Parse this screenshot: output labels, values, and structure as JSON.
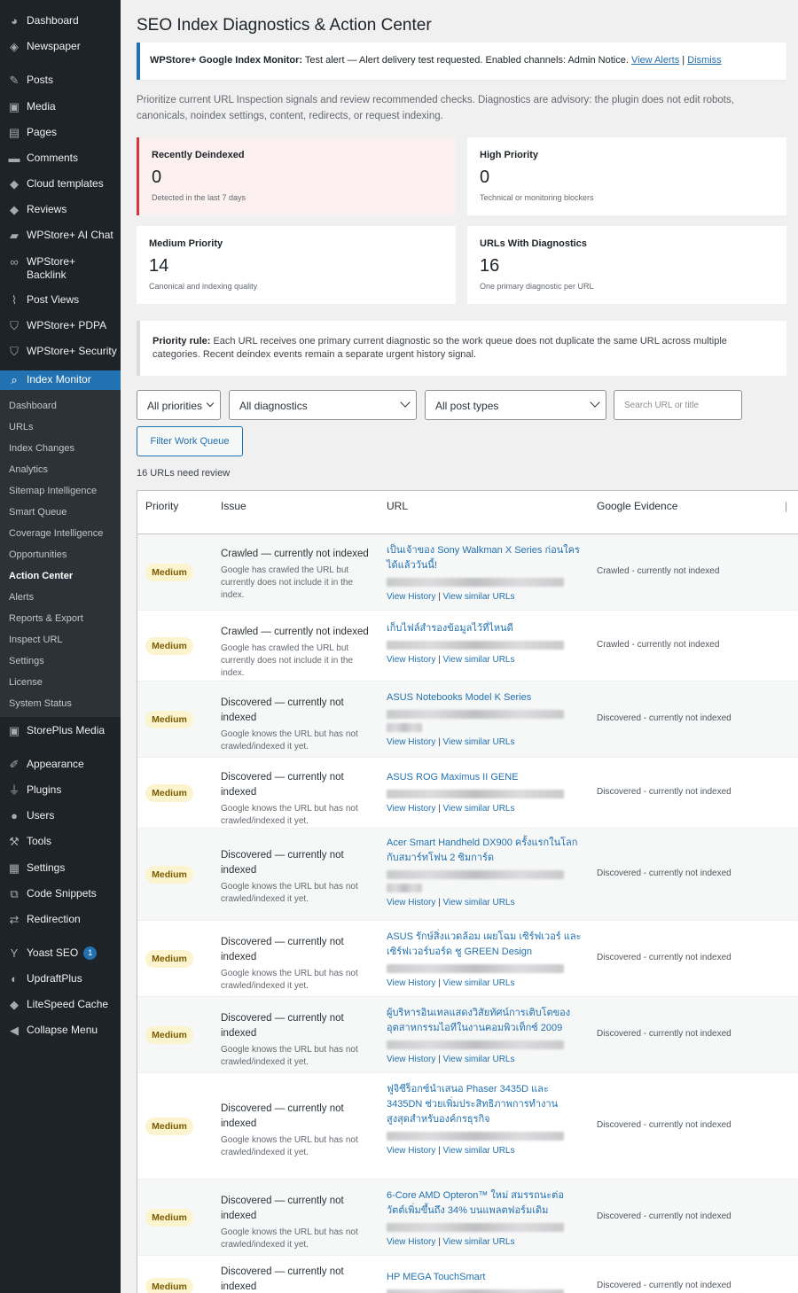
{
  "sidebar": {
    "items": [
      {
        "label": "Dashboard",
        "icon": "dashboard-icon"
      },
      {
        "label": "Newspaper",
        "icon": "newspaper-icon"
      },
      {
        "label": "Posts",
        "icon": "pin-icon"
      },
      {
        "label": "Media",
        "icon": "media-icon"
      },
      {
        "label": "Pages",
        "icon": "page-icon"
      },
      {
        "label": "Comments",
        "icon": "comment-icon"
      },
      {
        "label": "Cloud templates",
        "icon": "diamond-icon"
      },
      {
        "label": "Reviews",
        "icon": "diamond-icon"
      },
      {
        "label": "WPStore+ AI Chat",
        "icon": "chat-icon"
      },
      {
        "label": "WPStore+ Backlink",
        "icon": "link-icon"
      },
      {
        "label": "Post Views",
        "icon": "chart-icon"
      },
      {
        "label": "WPStore+ PDPA",
        "icon": "shield-icon"
      },
      {
        "label": "WPStore+ Security",
        "icon": "shield-icon"
      },
      {
        "label": "Index Monitor",
        "icon": "search-icon"
      },
      {
        "label": "StorePlus Media",
        "icon": "media-icon"
      },
      {
        "label": "Appearance",
        "icon": "brush-icon"
      },
      {
        "label": "Plugins",
        "icon": "plug-icon"
      },
      {
        "label": "Users",
        "icon": "user-icon"
      },
      {
        "label": "Tools",
        "icon": "wrench-icon"
      },
      {
        "label": "Settings",
        "icon": "settings-icon"
      },
      {
        "label": "Code Snippets",
        "icon": "code-icon"
      },
      {
        "label": "Redirection",
        "icon": "redirect-icon"
      },
      {
        "label": "Yoast SEO",
        "icon": "yoast-icon",
        "badge": "1"
      },
      {
        "label": "UpdraftPlus",
        "icon": "updraft-icon"
      },
      {
        "label": "LiteSpeed Cache",
        "icon": "diamond-icon"
      },
      {
        "label": "Collapse Menu",
        "icon": "collapse-icon"
      }
    ],
    "submenu": [
      "Dashboard",
      "URLs",
      "Index Changes",
      "Analytics",
      "Sitemap Intelligence",
      "Smart Queue",
      "Coverage Intelligence",
      "Opportunities",
      "Action Center",
      "Alerts",
      "Reports & Export",
      "Inspect URL",
      "Settings",
      "License",
      "System Status"
    ]
  },
  "page": {
    "title": "SEO Index Diagnostics & Action Center",
    "notice": {
      "strong": "WPStore+ Google Index Monitor:",
      "text": " Test alert — Alert delivery test requested. Enabled channels: Admin Notice. ",
      "link1": "View Alerts",
      "sep": " | ",
      "link2": "Dismiss"
    },
    "intro": "Prioritize current URL Inspection signals and review recommended checks. Diagnostics are advisory: the plugin does not edit robots, canonicals, noindex settings, content, redirects, or request indexing.",
    "cards": [
      {
        "title": "Recently Deindexed",
        "value": "0",
        "sub": "Detected in the last 7 days"
      },
      {
        "title": "High Priority",
        "value": "0",
        "sub": "Technical or monitoring blockers"
      },
      {
        "title": "Medium Priority",
        "value": "14",
        "sub": "Canonical and indexing quality"
      },
      {
        "title": "URLs With Diagnostics",
        "value": "16",
        "sub": "One primary diagnostic per URL"
      }
    ],
    "rule": {
      "strong": "Priority rule:",
      "text": " Each URL receives one primary current diagnostic so the work queue does not duplicate the same URL across multiple categories. Recent deindex events remain a separate urgent history signal."
    },
    "filters": {
      "priority": "All priorities",
      "diagnostics": "All diagnostics",
      "post_types": "All post types",
      "search_placeholder": "Search URL or title",
      "button": "Filter Work Queue"
    },
    "count": "16 URLs need review"
  },
  "table": {
    "headers": [
      "Priority",
      "Issue",
      "URL",
      "Google Evidence"
    ],
    "links": {
      "history": "View History",
      "sep": " | ",
      "similar": "View similar URLs"
    },
    "rows": [
      {
        "priority": "Medium",
        "issue": "Crawled — currently not indexed",
        "desc": "Google has crawled the URL but currently does not include it in the index.",
        "title": "เป็นเจ้าของ Sony Walkman X Series ก่อนใคร ได้แล้ววันนี้!",
        "evidence": "Crawled - currently not indexed"
      },
      {
        "priority": "Medium",
        "issue": "Crawled — currently not indexed",
        "desc": "Google has crawled the URL but currently does not include it in the index.",
        "title": "เก็บไฟล์สำรองข้อมูลไว้ที่ไหนดี",
        "evidence": "Crawled - currently not indexed"
      },
      {
        "priority": "Medium",
        "issue": "Discovered — currently not indexed",
        "desc": "Google knows the URL but has not crawled/indexed it yet.",
        "title": "ASUS Notebooks Model K Series",
        "evidence": "Discovered - currently not indexed"
      },
      {
        "priority": "Medium",
        "issue": "Discovered — currently not indexed",
        "desc": "Google knows the URL but has not crawled/indexed it yet.",
        "title": "ASUS ROG Maximus II GENE",
        "evidence": "Discovered - currently not indexed"
      },
      {
        "priority": "Medium",
        "issue": "Discovered — currently not indexed",
        "desc": "Google knows the URL but has not crawled/indexed it yet.",
        "title": "Acer Smart Handheld DX900 ครั้งแรกในโลก กับสมาร์ทโฟน 2 ซิมการ์ด",
        "evidence": "Discovered - currently not indexed"
      },
      {
        "priority": "Medium",
        "issue": "Discovered — currently not indexed",
        "desc": "Google knows the URL but has not crawled/indexed it yet.",
        "title": "ASUS รักษ์สิ่งแวดล้อม เผยโฉม เซิร์ฟเวอร์ และเซิร์ฟเวอร์บอร์ด ชู GREEN Design",
        "evidence": "Discovered - currently not indexed"
      },
      {
        "priority": "Medium",
        "issue": "Discovered — currently not indexed",
        "desc": "Google knows the URL but has not crawled/indexed it yet.",
        "title": "ผู้บริหารอินเทลแสดงวิสัยทัศน์การเติบโตของ อุตสาหกรรมไอทีในงานคอมพิวเท็กซ์ 2009",
        "evidence": "Discovered - currently not indexed"
      },
      {
        "priority": "Medium",
        "issue": "Discovered — currently not indexed",
        "desc": "Google knows the URL but has not crawled/indexed it yet.",
        "title": "ฟูจิซีร็อกซ์นำเสนอ Phaser 3435D และ 3435DN ช่วยเพิ่มประสิทธิภาพการทำงาน สูงสุดสำหรับองค์กรธุรกิจ",
        "evidence": "Discovered - currently not indexed"
      },
      {
        "priority": "Medium",
        "issue": "Discovered — currently not indexed",
        "desc": "Google knows the URL but has not crawled/indexed it yet.",
        "title": "6-Core AMD Opteron™ ใหม่ สมรรถนะต่อ วัตต์เพิ่มขึ้นถึง 34% บนแพลตฟอร์มเดิม",
        "evidence": "Discovered - currently not indexed"
      },
      {
        "priority": "Medium",
        "issue": "Discovered — currently not indexed",
        "desc": "",
        "title": "HP MEGA TouchSmart",
        "evidence": "Discovered - currently not indexed"
      }
    ]
  }
}
